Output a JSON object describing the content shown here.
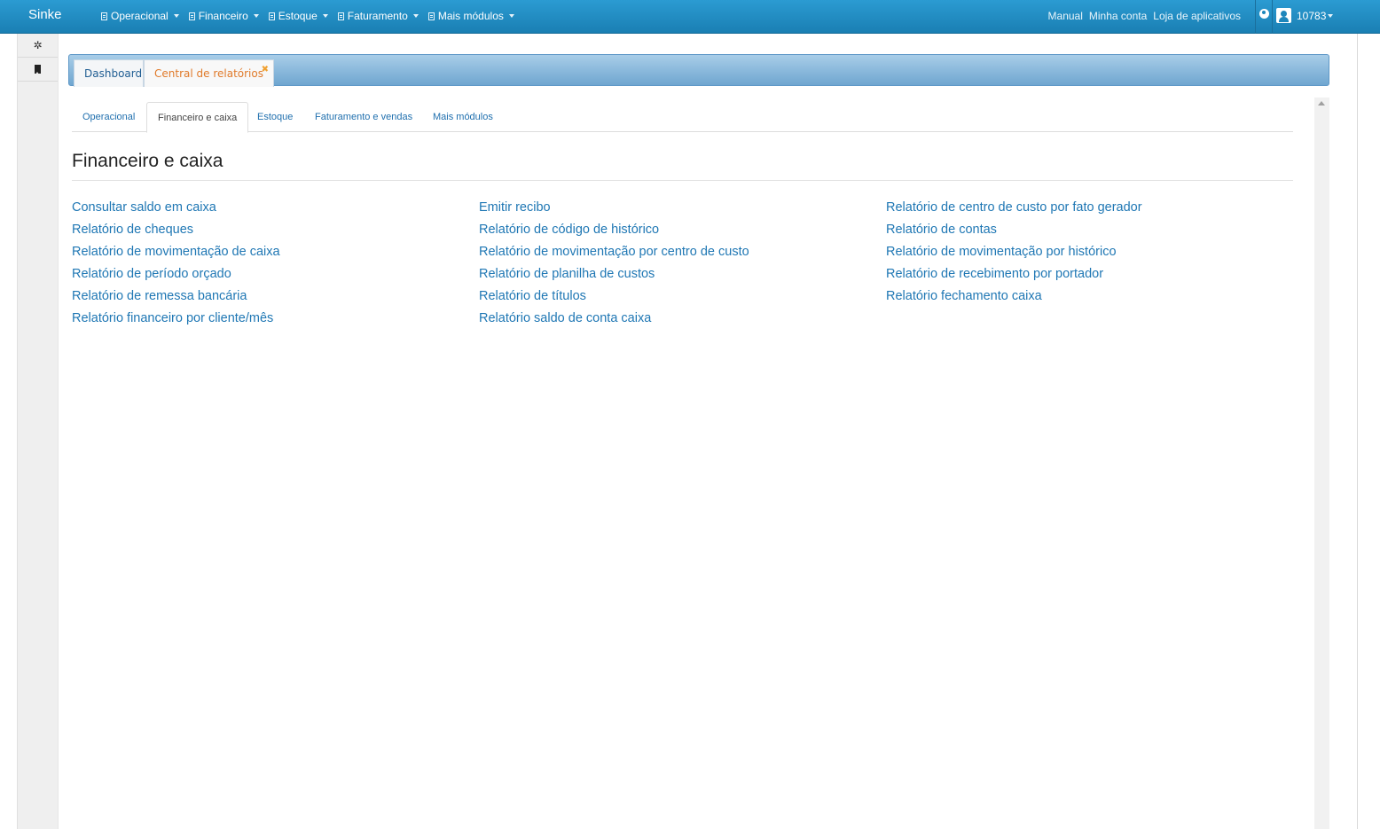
{
  "navbar": {
    "brand": "Sinke",
    "menu": [
      {
        "label": "Operacional"
      },
      {
        "label": "Financeiro"
      },
      {
        "label": "Estoque"
      },
      {
        "label": "Faturamento"
      },
      {
        "label": "Mais módulos"
      }
    ],
    "links": [
      "Manual",
      "Minha conta",
      "Loja de aplicativos"
    ],
    "user_id": "10783"
  },
  "tabs": [
    {
      "label": "Dashboard"
    },
    {
      "label": "Central de relatórios"
    }
  ],
  "subtabs": [
    {
      "label": "Operacional"
    },
    {
      "label": "Financeiro e caixa"
    },
    {
      "label": "Estoque"
    },
    {
      "label": "Faturamento e vendas"
    },
    {
      "label": "Mais módulos"
    }
  ],
  "active_subtab": "Financeiro e caixa",
  "section": {
    "title": "Financeiro e caixa",
    "columns": [
      [
        "Consultar saldo em caixa",
        "Relatório de cheques",
        "Relatório de movimentação de caixa",
        "Relatório de período orçado",
        "Relatório de remessa bancária",
        "Relatório financeiro por cliente/mês"
      ],
      [
        "Emitir recibo",
        "Relatório de código de histórico",
        "Relatório de movimentação por centro de custo",
        "Relatório de planilha de custos",
        "Relatório de títulos",
        "Relatório saldo de conta caixa"
      ],
      [
        "Relatório de centro de custo por fato gerador",
        "Relatório de contas",
        "Relatório de movimentação por histórico",
        "Relatório de recebimento por portador",
        "Relatório fechamento caixa"
      ]
    ]
  },
  "colors": {
    "navbar": "#1f8cc4",
    "link": "#1f77b4",
    "active_tab_text": "#e07a2a"
  }
}
